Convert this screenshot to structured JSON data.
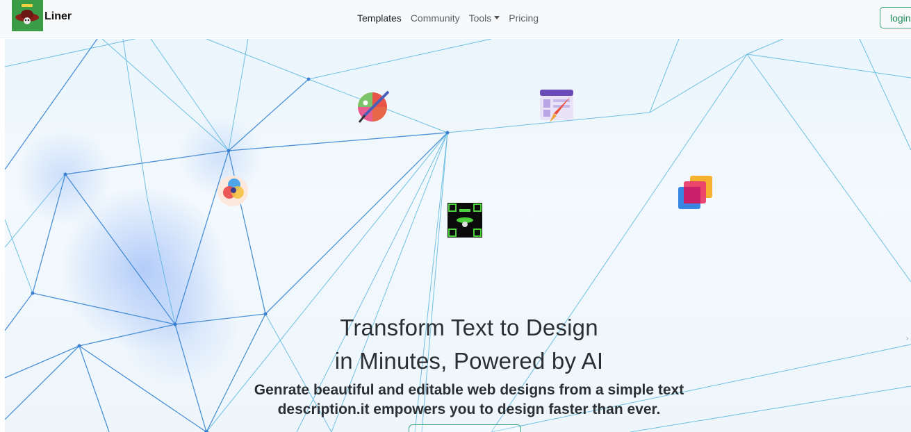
{
  "brand": {
    "name": "Liner",
    "logo_icon": "skull-hat-logo-icon"
  },
  "nav": {
    "links": [
      {
        "label": "Templates",
        "active": true
      },
      {
        "label": "Community",
        "active": false
      },
      {
        "label": "Tools",
        "active": false,
        "has_dropdown": true
      },
      {
        "label": "Pricing",
        "active": false
      }
    ],
    "login_label": "login"
  },
  "hero": {
    "title_line1": "Transform Text to Design",
    "title_line2": "in Minutes, Powered by AI",
    "subtitle_line1": "Genrate beautiful and editable web designs from a simple text",
    "subtitle_line2": "description.it empowers you to design faster than ever.",
    "floating_icons": [
      "paint-palette-icon",
      "web-design-brush-icon",
      "color-circles-icon",
      "qr-logo-icon",
      "layered-squares-icon"
    ]
  },
  "colors": {
    "accent": "#3aa27a",
    "network_line": "#2f7fd0",
    "logo_bg": "#3a9c46"
  }
}
